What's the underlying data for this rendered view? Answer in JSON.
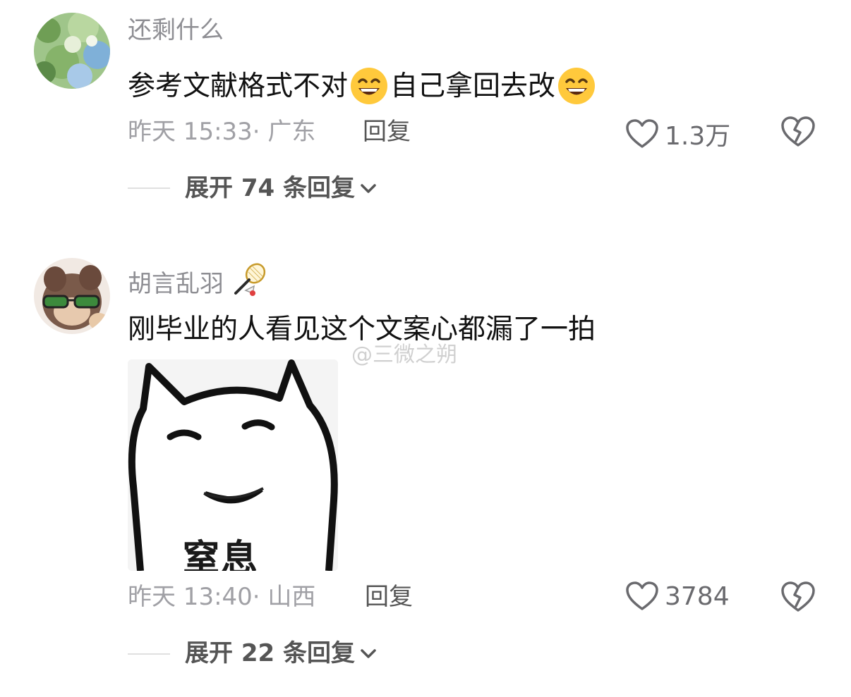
{
  "comments": [
    {
      "username": "还剩什么",
      "text_parts": [
        "参考文献格式不对",
        "自己拿回去改"
      ],
      "emoji": "grinning-face-emoji",
      "time_location": "昨天 15:33· 广东",
      "reply_label": "回复",
      "likes": "1.3万",
      "expand_label": "展开 74 条回复"
    },
    {
      "username": "胡言乱羽",
      "username_icon": "badminton-icon",
      "text": "刚毕业的人看见这个文案心都漏了一拍",
      "sticker_text": "窒息",
      "time_location": "昨天 13:40· 山西",
      "reply_label": "回复",
      "likes": "3784",
      "expand_label": "展开 22 条回复"
    }
  ],
  "watermark": "@三微之朔",
  "colors": {
    "username": "#8e8e93",
    "text": "#111111",
    "meta": "#a0a0a5",
    "emoji_yellow": "#ffc93c"
  }
}
